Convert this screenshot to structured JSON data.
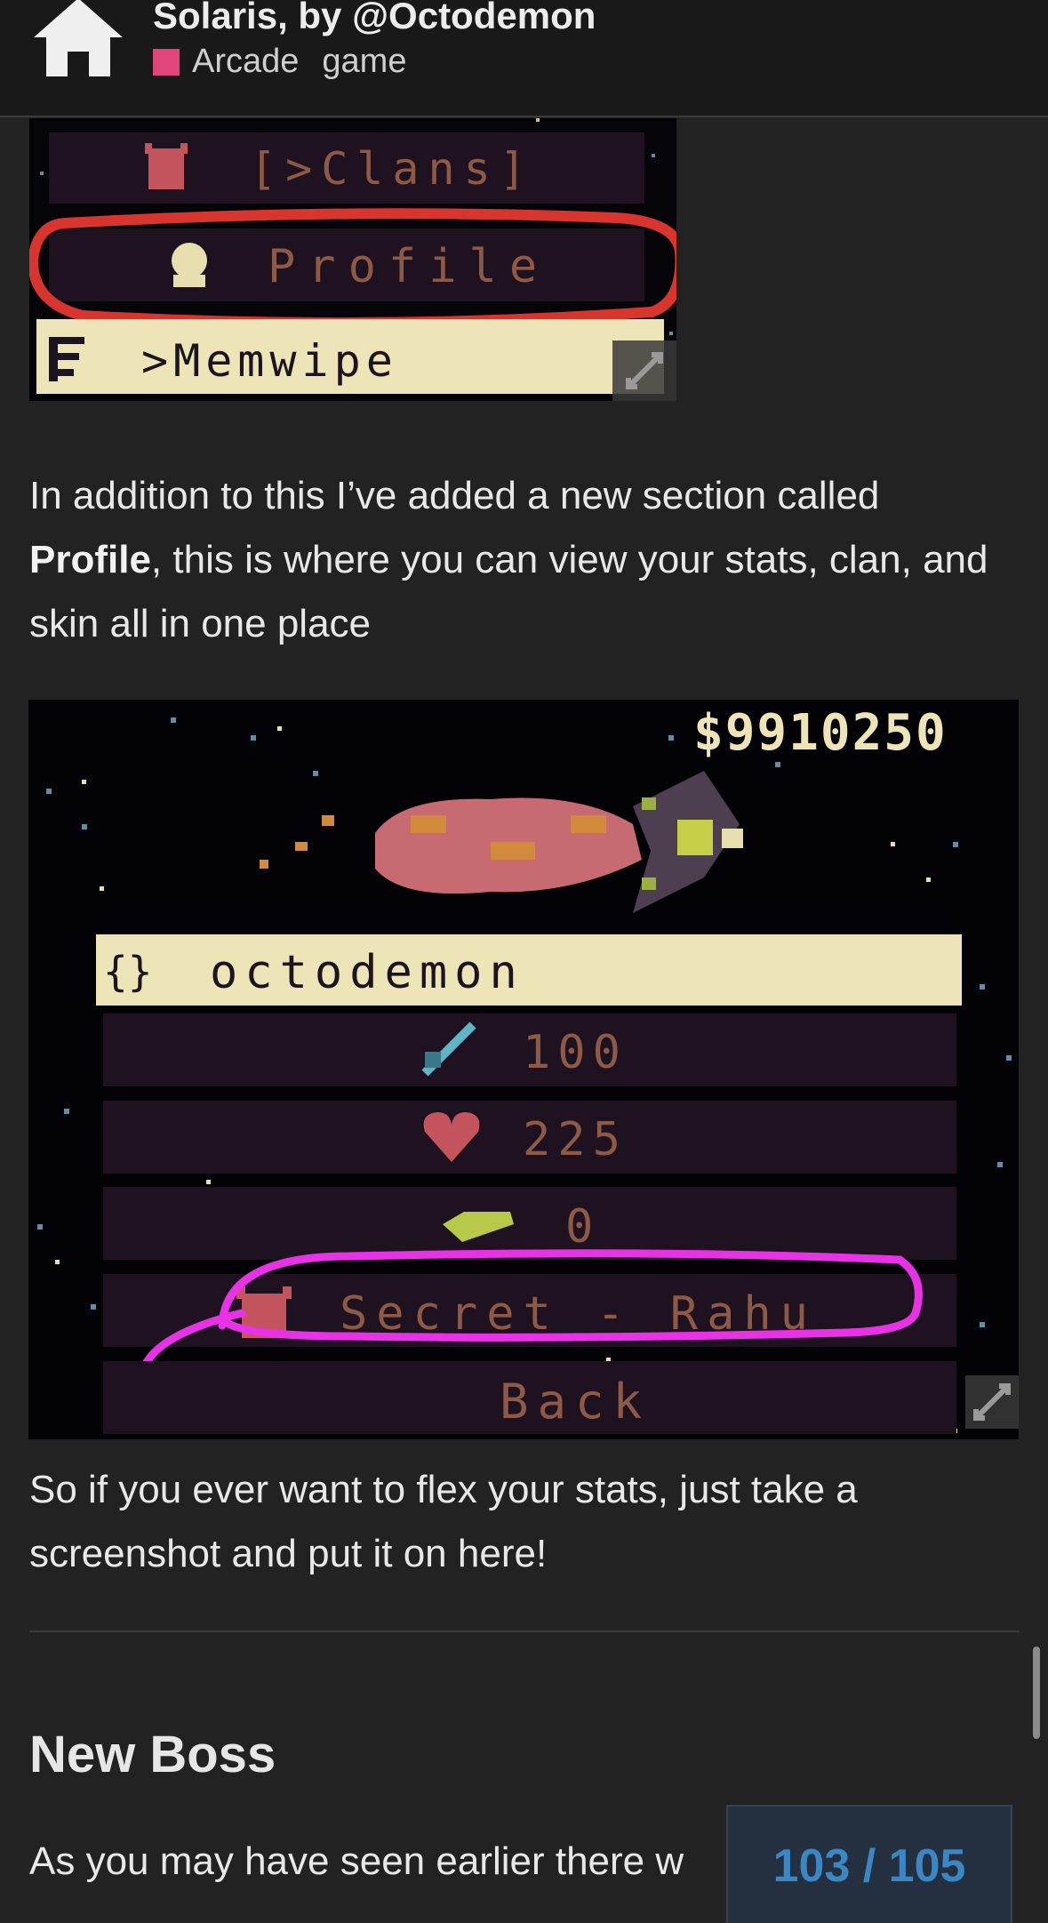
{
  "header": {
    "home_icon": "home-icon",
    "title": "Solaris, by @Octodemon",
    "category": "Arcade",
    "tag": "game",
    "category_color": "#e0457b"
  },
  "image1": {
    "menu_items": [
      "[>Clans]",
      "Profile",
      ">Memwipe"
    ],
    "icons": [
      "demon-icon",
      "person-icon",
      "list-icon"
    ],
    "annotation_color": "#d7352d",
    "expand_icon": "expand-icon"
  },
  "post": {
    "para1_prefix": "In addition to this I’ve added a new section called ",
    "para1_bold": "Profile",
    "para1_suffix": ", this is where you can view your stats, clan, and skin all in one place",
    "para2": "So if you ever want to flex your stats, just take a screenshot and put it on here!",
    "heading": "New Boss",
    "para3": "As you may have seen earlier there w"
  },
  "image2": {
    "money": "$9910250",
    "username": "octodemon",
    "stats": [
      {
        "icon": "sword-icon",
        "value": "100"
      },
      {
        "icon": "heart-icon",
        "value": "225"
      },
      {
        "icon": "shield-icon",
        "value": "0"
      }
    ],
    "clan": "Secret - Rahu",
    "back": "Back",
    "annotation_color": "#e832e6",
    "expand_icon": "expand-icon"
  },
  "progress": {
    "label": "103 / 105"
  }
}
